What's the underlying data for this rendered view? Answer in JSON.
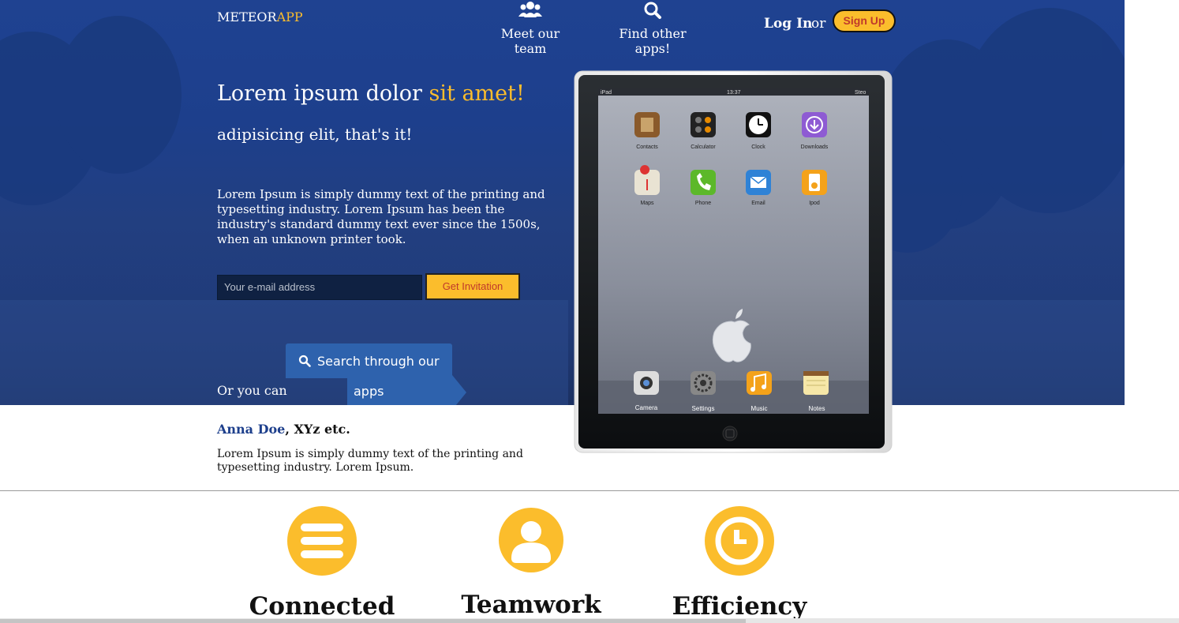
{
  "brand": {
    "part1": "METEOR",
    "part2": "APP",
    "accent": "#fbbd2c"
  },
  "nav": {
    "team": {
      "label": "Meet our team",
      "icon": "users-icon"
    },
    "find": {
      "label": "Find other apps!",
      "icon": "search-icon"
    },
    "login": "Log In",
    "or": "or",
    "signup": "Sign Up"
  },
  "hero": {
    "headline_main": "Lorem ipsum dolor ",
    "headline_accent": "sit amet!",
    "subtitle": "adipisicing elit, that's it!",
    "paragraph": "Lorem Ipsum is simply dummy text of the printing and typesetting industry. Lorem Ipsum has been the industry's standard dummy text ever since the 1500s, when an unknown printer took.",
    "email_placeholder": "Your e-mail address",
    "invite_button": "Get Invitation",
    "or_you_can": "Or you can",
    "search_line1": "Search through our",
    "search_line2": "apps",
    "background_color": "#1f4291"
  },
  "testimonial": {
    "name": "Anna Doe",
    "suffix": ", XYz etc.",
    "text": "Lorem Ipsum is simply dummy text of the printing and typesetting industry. Lorem Ipsum."
  },
  "ipad": {
    "status_left": "iPad",
    "status_time": "13:37",
    "status_right": "Steo",
    "apps_row1": [
      "Contacts",
      "Calculator",
      "Clock",
      "Downloads"
    ],
    "apps_row2": [
      "Maps",
      "Phone",
      "Email",
      "Ipod"
    ],
    "dock": [
      "Camera",
      "Settings",
      "Music",
      "Notes"
    ]
  },
  "features": [
    {
      "title": "Connected",
      "icon": "menu-bars-icon"
    },
    {
      "title": "Teamwork",
      "icon": "user-icon"
    },
    {
      "title": "Efficiency",
      "icon": "clock-icon"
    }
  ]
}
